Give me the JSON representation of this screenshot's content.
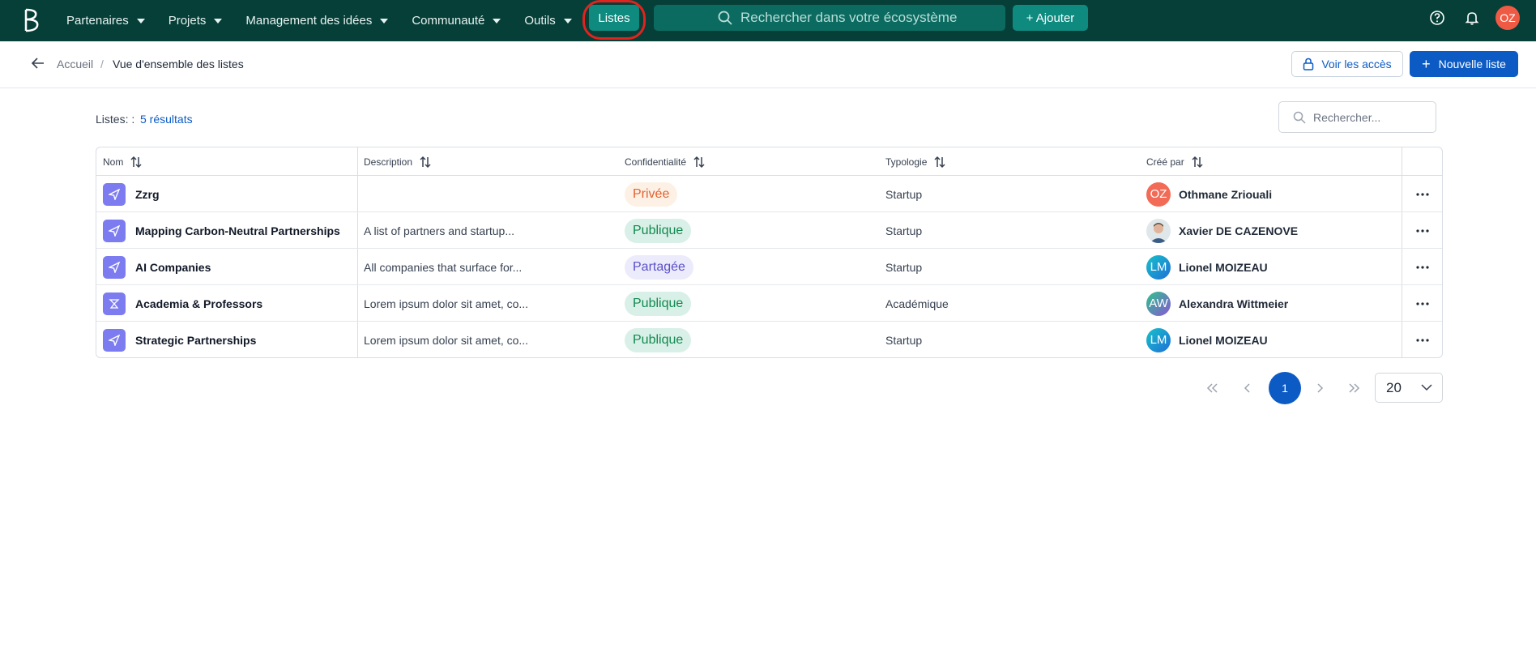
{
  "topnav": {
    "items": [
      {
        "label": "Partenaires"
      },
      {
        "label": "Projets"
      },
      {
        "label": "Management des idées"
      },
      {
        "label": "Communauté"
      },
      {
        "label": "Outils"
      }
    ],
    "listes_label": "Listes",
    "search_placeholder": "Rechercher dans votre écosystème",
    "add_label": "+ Ajouter",
    "user_initials": "OZ"
  },
  "breadcrumb": {
    "home": "Accueil",
    "separator": "/",
    "current": "Vue d'ensemble des listes"
  },
  "actions": {
    "access_label": "Voir les accès",
    "new_label": "Nouvelle liste",
    "new_plus": "+"
  },
  "results": {
    "label": "Listes: :",
    "count": "5 résultats"
  },
  "list_search_placeholder": "Rechercher...",
  "table": {
    "headers": {
      "name": "Nom",
      "description": "Description",
      "confidentiality": "Confidentialité",
      "typology": "Typologie",
      "created_by": "Créé par"
    },
    "rows": [
      {
        "icon": "rocket-icon",
        "name": "Zzrg",
        "description": "",
        "confidentiality": "Privée",
        "typology": "Startup",
        "user": "Othmane Zriouali",
        "initials": "OZ"
      },
      {
        "icon": "rocket-icon",
        "name": "Mapping Carbon-Neutral Partnerships",
        "description": "A list of partners and startup...",
        "confidentiality": "Publique",
        "typology": "Startup",
        "user": "Xavier DE CAZENOVE",
        "initials": ""
      },
      {
        "icon": "rocket-icon",
        "name": "AI Companies",
        "description": "All companies that surface for...",
        "confidentiality": "Partagée",
        "typology": "Startup",
        "user": "Lionel MOIZEAU",
        "initials": "LM"
      },
      {
        "icon": "academic-icon",
        "name": "Academia & Professors",
        "description": "Lorem ipsum dolor sit amet, co...",
        "confidentiality": "Publique",
        "typology": "Académique",
        "user": "Alexandra Wittmeier",
        "initials": "AW"
      },
      {
        "icon": "rocket-icon",
        "name": "Strategic Partnerships",
        "description": "Lorem ipsum dolor sit amet, co...",
        "confidentiality": "Publique",
        "typology": "Startup",
        "user": "Lionel MOIZEAU",
        "initials": "LM"
      }
    ]
  },
  "pagination": {
    "current_page": "1",
    "page_size": "20"
  },
  "colors": {
    "topbar": "#063f38",
    "accent_teal": "#0e8a7f",
    "primary_blue": "#0c5bc4",
    "privee_bg": "#fdf1e6",
    "privee_text": "#e2612f",
    "publique_bg": "#d8f0e7",
    "publique_text": "#12894f",
    "partagee_bg": "#ecebfb",
    "partagee_text": "#5a4fc8"
  }
}
